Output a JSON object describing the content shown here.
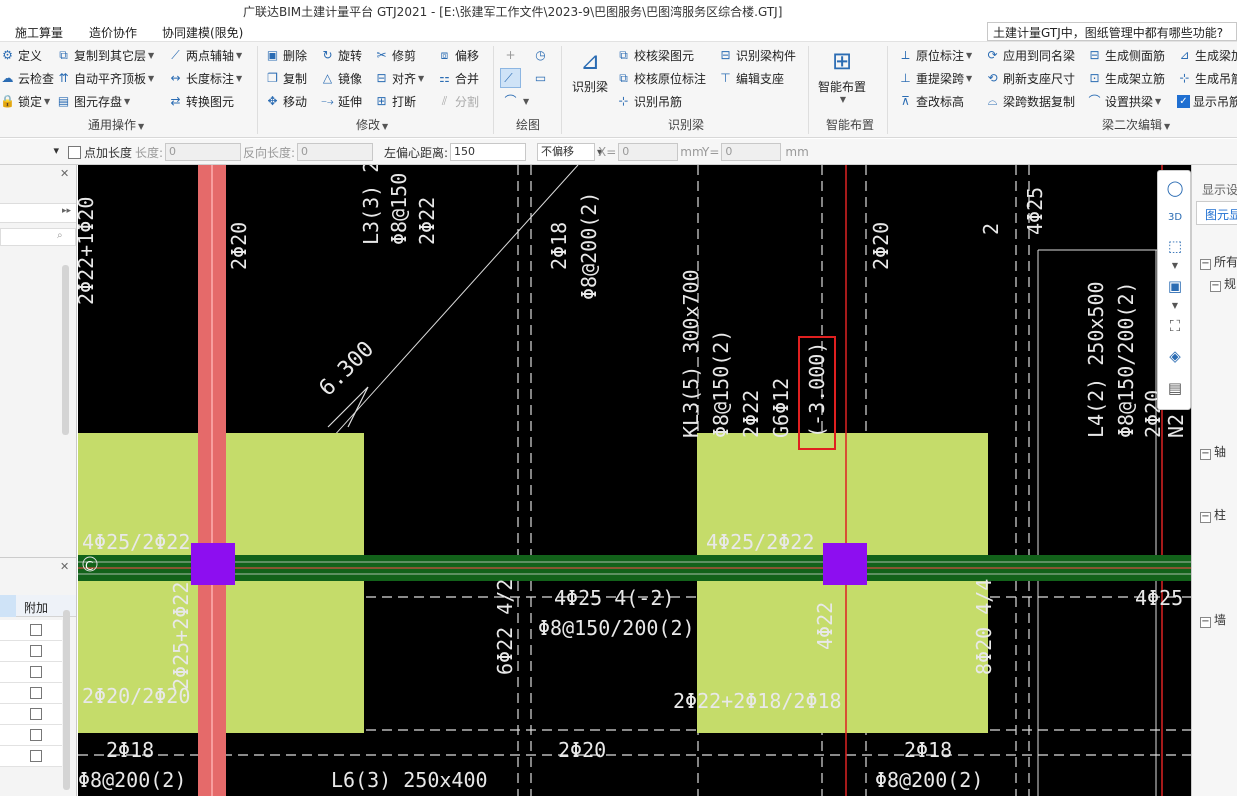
{
  "window": {
    "title": "广联达BIM土建计量平台 GTJ2021 - [E:\\张建军工作文件\\2023-9\\巴图服务\\巴图湾服务区综合楼.GTJ]"
  },
  "menu": {
    "items": [
      "施工算量",
      "造价协作",
      "协同建模(限免)"
    ]
  },
  "help_search": {
    "value": "土建计量GTJ中，图纸管理中都有哪些功能?"
  },
  "ribbon": {
    "common": {
      "label": "通用操作",
      "items": [
        "定义",
        "云检查",
        "锁定",
        "复制到其它层",
        "自动平齐顶板",
        "图元存盘",
        "两点辅轴",
        "长度标注",
        "转换图元"
      ]
    },
    "modify": {
      "label": "修改",
      "items": [
        "删除",
        "复制",
        "移动",
        "旋转",
        "镜像",
        "延伸",
        "修剪",
        "对齐",
        "打断",
        "偏移",
        "合并",
        "分割"
      ]
    },
    "draw": {
      "label": "绘图"
    },
    "recognize": {
      "label": "识别梁",
      "big": "识别梁",
      "items": [
        "校核梁图元",
        "校核原位标注",
        "识别吊筋",
        "识别梁构件",
        "编辑支座"
      ]
    },
    "smart": {
      "label": "智能布置",
      "big": "智能布置"
    },
    "secondary": {
      "label": "梁二次编辑",
      "items": [
        "原位标注",
        "重提梁跨",
        "查改标高",
        "应用到同名梁",
        "刷新支座尺寸",
        "梁跨数据复制",
        "生成侧面筋",
        "生成架立筋",
        "设置拱梁",
        "生成梁加",
        "生成吊筋",
        "显示吊筋"
      ]
    }
  },
  "options": {
    "point_length_label": "点加长度",
    "length_label": "长度:",
    "length_value": "0",
    "reverse_length_label": "反向长度:",
    "reverse_length_value": "0",
    "left_offset_label": "左偏心距离:",
    "left_offset_value": "150",
    "offset_mode": "不偏移",
    "x_label": "X=",
    "x_value": "0",
    "y_label": "Y=",
    "y_value": "0",
    "unit": "mm"
  },
  "left_panel": {
    "col_header": "附加"
  },
  "right_panel": {
    "tab1": "显示设",
    "tab2": "图元显",
    "section_all": "所有",
    "sections": [
      "规",
      "轴",
      "柱",
      "墙"
    ]
  },
  "cad": {
    "labels": {
      "a": "2Φ22+1Φ20",
      "b": "2Φ20",
      "c": "L3(3) 2",
      "d": "Φ8@150",
      "e": "2Φ22",
      "f": "2Φ18",
      "g": "Φ8@200(2)",
      "h": "2Φ20",
      "i": "6.300",
      "j": "KL3(5) 300x700",
      "k": "Φ8@150(2)",
      "l": "2Φ22",
      "m": "G6Φ12",
      "n": "(-3.000)",
      "o": "2Φ20",
      "p": "L4(2) 250x500",
      "q": "Φ8@150/200(2)",
      "r": "2Φ20",
      "s": "N2",
      "t": "4Φ25",
      "u": "4Φ25/2Φ22",
      "v": "C",
      "w": "2Φ25+2Φ22",
      "x": "4Φ25/2Φ22",
      "y": "4Φ25 4(-2)",
      "z": "Φ8@150/200(2)",
      "aa": "6Φ22 4/2",
      "ab": "4Φ22",
      "ac": "8Φ20 4/4",
      "ad": "4Φ25",
      "ae": "2Φ20/2Φ20",
      "af": "2Φ22+2Φ18/2Φ18",
      "ag": "2Φ18",
      "ah": "2Φ20",
      "ai": "2Φ18",
      "aj": "Φ8@200(2)",
      "ak": "L6(3) 250x400",
      "al": "Φ8@200(2)",
      "am": "2"
    }
  }
}
